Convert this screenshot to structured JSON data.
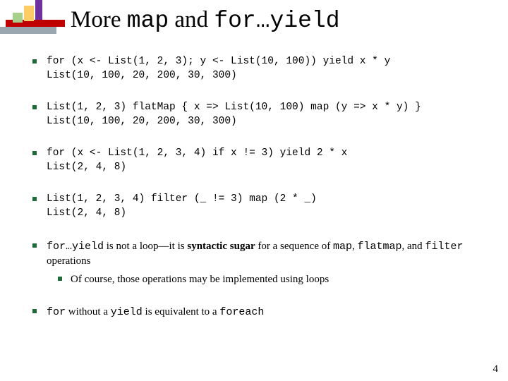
{
  "title": {
    "part1": "More ",
    "code1": "map",
    "part2": " and ",
    "code2": "for…yield"
  },
  "bullets": [
    {
      "type": "code",
      "lines": [
        "for (x <- List(1, 2, 3); y <- List(10, 100)) yield x * y",
        "List(10, 100, 20, 200, 30, 300)"
      ]
    },
    {
      "type": "code",
      "lines": [
        "List(1, 2, 3) flatMap { x => List(10, 100) map (y => x * y) }",
        "List(10, 100, 20, 200, 30, 300)"
      ]
    },
    {
      "type": "code",
      "lines": [
        "for (x <- List(1, 2, 3, 4) if x != 3) yield 2 * x",
        "List(2, 4, 8)"
      ]
    },
    {
      "type": "code",
      "lines": [
        "List(1, 2, 3, 4) filter (_ != 3) map (2 * _)",
        "List(2, 4, 8)"
      ]
    },
    {
      "type": "prose",
      "segments": [
        {
          "code": "for…yield"
        },
        {
          "text": " is not a loop—it is "
        },
        {
          "bold": "syntactic sugar"
        },
        {
          "text": " for a sequence of "
        },
        {
          "code": "map"
        },
        {
          "text": ", "
        },
        {
          "code": "flatmap"
        },
        {
          "text": ", and "
        },
        {
          "code": "filter"
        },
        {
          "text": " operations"
        }
      ],
      "sub": [
        {
          "text": "Of course, those operations may be implemented using loops"
        }
      ]
    },
    {
      "type": "prose",
      "segments": [
        {
          "code": "for"
        },
        {
          "text": " without a "
        },
        {
          "code": "yield"
        },
        {
          "text": " is equivalent to a "
        },
        {
          "code": "foreach"
        }
      ]
    }
  ],
  "page_number": "4"
}
